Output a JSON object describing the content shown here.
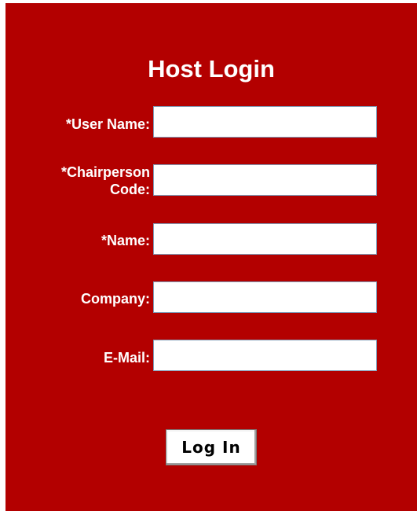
{
  "form": {
    "title": "Host Login",
    "fields": [
      {
        "label": "*User Name:",
        "value": ""
      },
      {
        "label": "*Chairperson\nCode:",
        "value": ""
      },
      {
        "label": "*Name:",
        "value": ""
      },
      {
        "label": "Company:",
        "value": ""
      },
      {
        "label": "E-Mail:",
        "value": ""
      }
    ],
    "submit_label": "Log In"
  },
  "colors": {
    "panel_background": "#b30000",
    "text": "#ffffff",
    "field_border": "#7f9db9"
  }
}
